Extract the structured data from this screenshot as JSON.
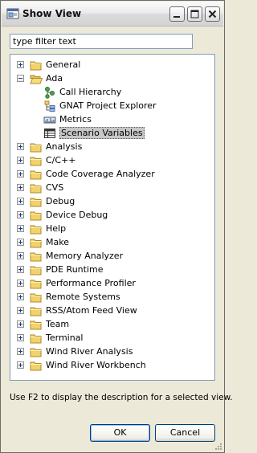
{
  "window": {
    "title": "Show View"
  },
  "filter": {
    "value": "type filter text"
  },
  "tree": {
    "items": [
      {
        "label": "General",
        "icon": "folder-icon",
        "level": 0,
        "expander": "plus"
      },
      {
        "label": "Ada",
        "icon": "folder-open-icon",
        "level": 0,
        "expander": "minus"
      },
      {
        "label": "Call Hierarchy",
        "icon": "call-hierarchy-icon",
        "level": 1,
        "expander": "none"
      },
      {
        "label": "GNAT Project Explorer",
        "icon": "project-explorer-icon",
        "level": 1,
        "expander": "none"
      },
      {
        "label": "Metrics",
        "icon": "metrics-icon",
        "level": 1,
        "expander": "none"
      },
      {
        "label": "Scenario Variables",
        "icon": "scenario-variables-icon",
        "level": 1,
        "expander": "none",
        "selected": true
      },
      {
        "label": "Analysis",
        "icon": "folder-icon",
        "level": 0,
        "expander": "plus"
      },
      {
        "label": "C/C++",
        "icon": "folder-icon",
        "level": 0,
        "expander": "plus"
      },
      {
        "label": "Code Coverage Analyzer",
        "icon": "folder-icon",
        "level": 0,
        "expander": "plus"
      },
      {
        "label": "CVS",
        "icon": "folder-icon",
        "level": 0,
        "expander": "plus"
      },
      {
        "label": "Debug",
        "icon": "folder-icon",
        "level": 0,
        "expander": "plus"
      },
      {
        "label": "Device Debug",
        "icon": "folder-icon",
        "level": 0,
        "expander": "plus"
      },
      {
        "label": "Help",
        "icon": "folder-icon",
        "level": 0,
        "expander": "plus"
      },
      {
        "label": "Make",
        "icon": "folder-icon",
        "level": 0,
        "expander": "plus"
      },
      {
        "label": "Memory Analyzer",
        "icon": "folder-icon",
        "level": 0,
        "expander": "plus"
      },
      {
        "label": "PDE Runtime",
        "icon": "folder-icon",
        "level": 0,
        "expander": "plus"
      },
      {
        "label": "Performance Profiler",
        "icon": "folder-icon",
        "level": 0,
        "expander": "plus"
      },
      {
        "label": "Remote Systems",
        "icon": "folder-icon",
        "level": 0,
        "expander": "plus"
      },
      {
        "label": "RSS/Atom Feed View",
        "icon": "folder-icon",
        "level": 0,
        "expander": "plus"
      },
      {
        "label": "Team",
        "icon": "folder-icon",
        "level": 0,
        "expander": "plus"
      },
      {
        "label": "Terminal",
        "icon": "folder-icon",
        "level": 0,
        "expander": "plus"
      },
      {
        "label": "Wind River Analysis",
        "icon": "folder-icon",
        "level": 0,
        "expander": "plus"
      },
      {
        "label": "Wind River Workbench",
        "icon": "folder-icon",
        "level": 0,
        "expander": "plus"
      }
    ]
  },
  "hint": "Use F2 to display the description for a selected view.",
  "buttons": {
    "ok": "OK",
    "cancel": "Cancel"
  },
  "colors": {
    "folder": "#f2d36b",
    "selection": "#c7c7c7",
    "field_border": "#7f9db9"
  }
}
